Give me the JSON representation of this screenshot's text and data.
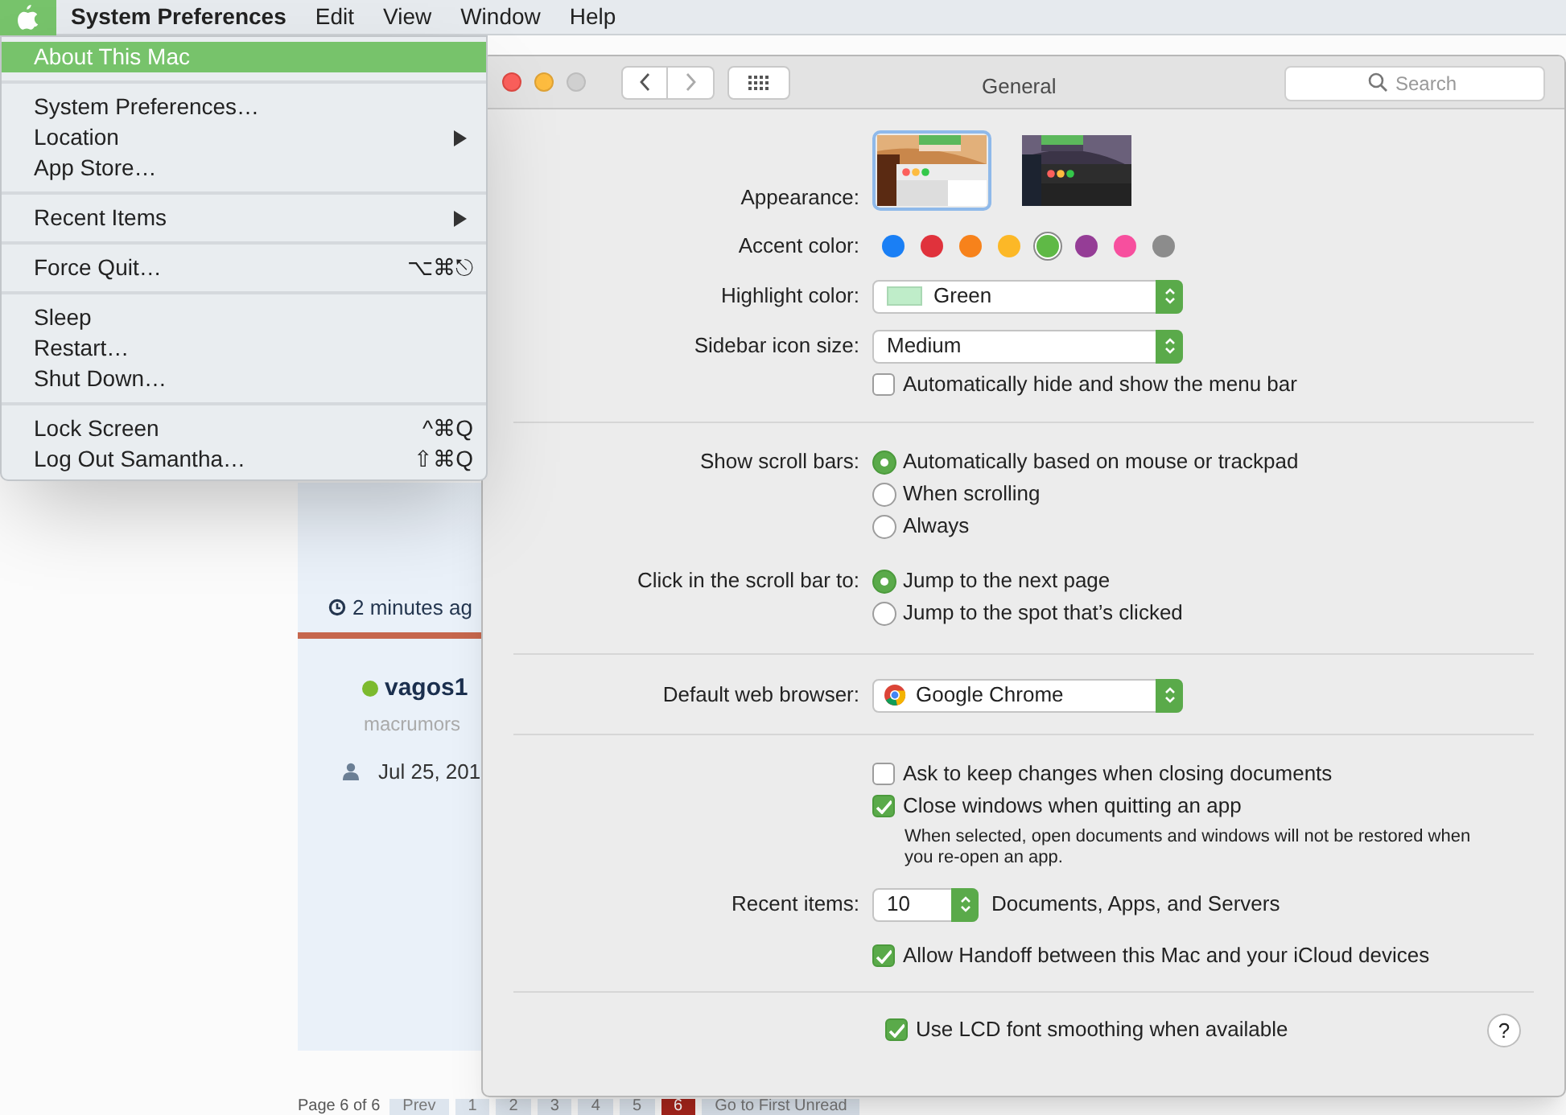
{
  "menu_bar": {
    "apple_selected": true,
    "items": [
      {
        "label": "System Preferences",
        "bold": true
      },
      {
        "label": "Edit",
        "bold": false
      },
      {
        "label": "View",
        "bold": false
      },
      {
        "label": "Window",
        "bold": false
      },
      {
        "label": "Help",
        "bold": false
      }
    ]
  },
  "apple_menu": {
    "groups": [
      [
        {
          "label": "About This Mac",
          "selected": true
        }
      ],
      [
        {
          "label": "System Preferences…",
          "selected": false
        },
        {
          "label": "Location",
          "submenu": true,
          "selected": false
        },
        {
          "label": "App Store…",
          "selected": false
        }
      ],
      [
        {
          "label": "Recent Items",
          "submenu": true,
          "selected": false
        }
      ],
      [
        {
          "label": "Force Quit…",
          "shortcut": "⌥⌘⎋",
          "selected": false
        }
      ],
      [
        {
          "label": "Sleep",
          "selected": false
        },
        {
          "label": "Restart…",
          "selected": false
        },
        {
          "label": "Shut Down…",
          "selected": false
        }
      ],
      [
        {
          "label": "Lock Screen",
          "shortcut": "^⌘Q",
          "selected": false
        },
        {
          "label": "Log Out Samantha…",
          "shortcut": "⇧⌘Q",
          "selected": false
        }
      ]
    ]
  },
  "background_page": {
    "time": "2 minutes ag",
    "username": "vagos1",
    "role": "macrumors",
    "joined": "Jul 25, 201",
    "pagination": {
      "label": "Page 6 of 6",
      "pages": [
        {
          "label": "Prev",
          "selected": false
        },
        {
          "label": "1",
          "selected": false
        },
        {
          "label": "2",
          "selected": false
        },
        {
          "label": "3",
          "selected": false
        },
        {
          "label": "4",
          "selected": false
        },
        {
          "label": "5",
          "selected": false
        },
        {
          "label": "6",
          "selected": true
        },
        {
          "label": "Go to First Unread",
          "selected": false
        }
      ]
    }
  },
  "prefs_window": {
    "title": "General",
    "search": {
      "placeholder": "Search"
    },
    "appearance": {
      "label": "Appearance:",
      "options": [
        {
          "kind": "light",
          "selected": true
        },
        {
          "kind": "dark",
          "selected": false
        }
      ]
    },
    "accent_color": {
      "label": "Accent color:",
      "options": [
        {
          "color": "#1a7ff5",
          "selected": false
        },
        {
          "color": "#e0323c",
          "selected": false
        },
        {
          "color": "#f7821b",
          "selected": false
        },
        {
          "color": "#fcb827",
          "selected": false
        },
        {
          "color": "#5fb946",
          "selected": true
        },
        {
          "color": "#953d96",
          "selected": false
        },
        {
          "color": "#f74f9e",
          "selected": false
        },
        {
          "color": "#8c8c8c",
          "selected": false
        }
      ]
    },
    "highlight_color": {
      "label": "Highlight color:",
      "value": "Green",
      "color": "#bfedc9"
    },
    "sidebar_icon_size": {
      "label": "Sidebar icon size:",
      "value": "Medium"
    },
    "auto_hide_menu_bar": {
      "label": "Automatically hide and show the menu bar",
      "checked": false
    },
    "show_scroll_bars": {
      "label": "Show scroll bars:",
      "options": [
        {
          "label": "Automatically based on mouse or trackpad",
          "selected": true
        },
        {
          "label": "When scrolling",
          "selected": false
        },
        {
          "label": "Always",
          "selected": false
        }
      ]
    },
    "click_scroll_bar": {
      "label": "Click in the scroll bar to:",
      "options": [
        {
          "label": "Jump to the next page",
          "selected": true
        },
        {
          "label": "Jump to the spot that’s clicked",
          "selected": false
        }
      ]
    },
    "default_web_browser": {
      "label": "Default web browser:",
      "value": "Google Chrome"
    },
    "ask_keep_changes": {
      "label": "Ask to keep changes when closing documents",
      "checked": false
    },
    "close_windows": {
      "label": "Close windows when quitting an app",
      "checked": true,
      "note": "When selected, open documents and windows will not be restored when you re-open an app."
    },
    "recent_items": {
      "label": "Recent items:",
      "value": "10",
      "suffix": "Documents, Apps, and Servers"
    },
    "allow_handoff": {
      "label": "Allow Handoff between this Mac and your iCloud devices",
      "checked": true
    },
    "lcd_smoothing": {
      "label": "Use LCD font smoothing when available",
      "checked": true
    },
    "help": "?"
  }
}
